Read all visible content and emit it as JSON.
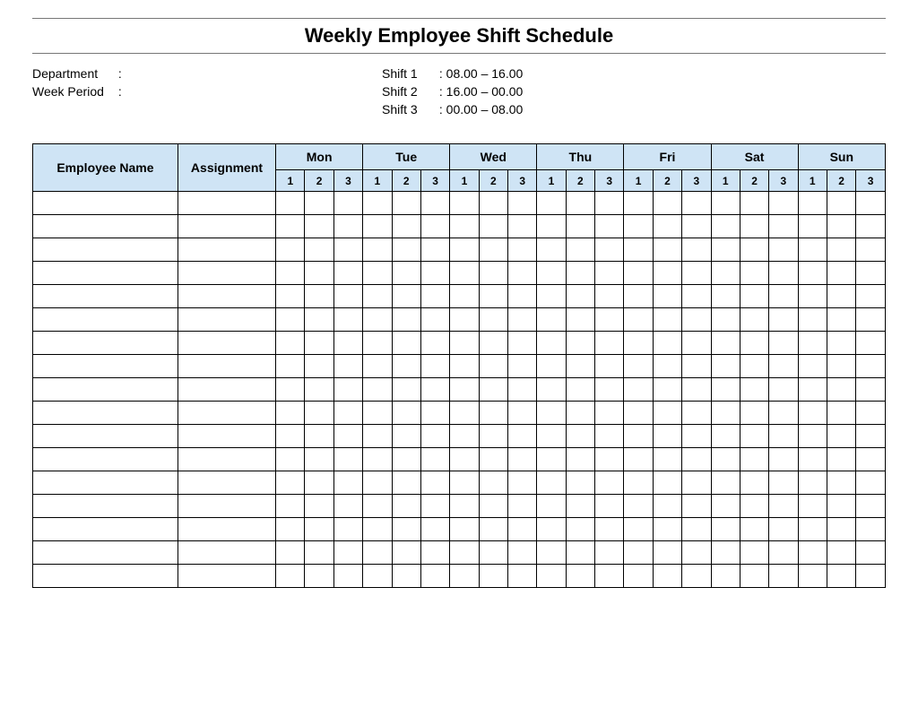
{
  "title": "Weekly Employee Shift Schedule",
  "meta": {
    "department_label": "Department",
    "department_colon": ":",
    "week_period_label": "Week  Period",
    "week_period_colon": ":",
    "shifts": [
      {
        "label": "Shift 1",
        "times": ": 08.00  –  16.00"
      },
      {
        "label": "Shift 2",
        "times": ": 16.00  –  00.00"
      },
      {
        "label": "Shift 3",
        "times": ": 00.00  –  08.00"
      }
    ]
  },
  "table": {
    "employee_name_header": "Employee Name",
    "assignment_header": "Assignment",
    "days": [
      "Mon",
      "Tue",
      "Wed",
      "Thu",
      "Fri",
      "Sat",
      "Sun"
    ],
    "shift_nums": [
      "1",
      "2",
      "3"
    ],
    "row_count": 17
  },
  "colors": {
    "header_bg": "#cfe4f5",
    "border": "#000000"
  }
}
